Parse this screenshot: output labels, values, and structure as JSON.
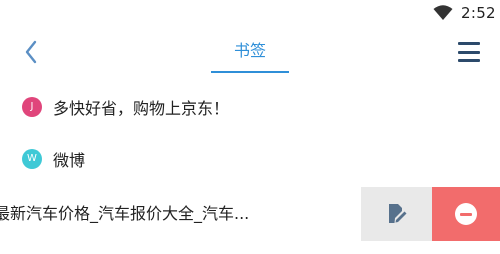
{
  "status_bar": {
    "time": "2:52",
    "wifi_icon": "wifi-icon"
  },
  "toolbar": {
    "back_icon": "chevron-left-icon",
    "title": "书签",
    "menu_icon": "hamburger-menu-icon",
    "accent_color": "#2f8fd8"
  },
  "bookmarks": [
    {
      "avatar_letter": "J",
      "avatar_color": "#e0457b",
      "label": "多快好省，购物上京东！"
    },
    {
      "avatar_letter": "W",
      "avatar_color": "#3fc9d6",
      "label": "微博"
    }
  ],
  "swiped_item": {
    "label": "最新汽车价格_汽车报价大全_汽车...",
    "edit_icon": "edit-icon",
    "delete_icon": "delete-minus-icon",
    "edit_bg": "#e9e9e9",
    "delete_bg": "#f26c6c"
  }
}
